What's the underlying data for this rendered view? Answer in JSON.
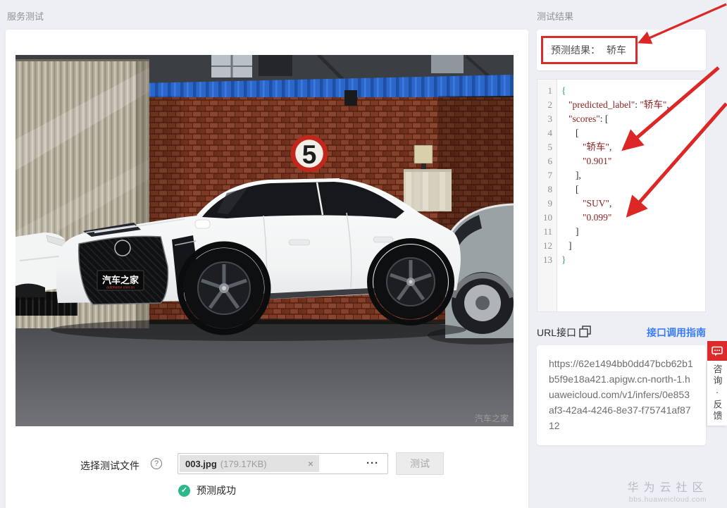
{
  "left_panel": {
    "header": "服务测试",
    "file_row": {
      "label": "选择测试文件",
      "help_glyph": "?",
      "file_chip": {
        "name": "003.jpg",
        "size": "(179.17KB)",
        "remove_glyph": "×"
      },
      "more_glyph": "···",
      "test_button": "测试"
    },
    "status": {
      "check_glyph": "✓",
      "text": "预测成功",
      "color": "#2bb98c"
    },
    "photo": {
      "speed_sign_text": "5",
      "plate_line1": "汽车之家",
      "plate_line2": "autohome.com.cn",
      "watermark": "汽车之家"
    }
  },
  "right_panel": {
    "header": "测试结果",
    "result_card": {
      "label": "预测结果：",
      "value": "轿车"
    },
    "accent_red": "#d92b2b",
    "link_blue": "#3b7cfa",
    "code_block": {
      "string_color": "#8b2121",
      "brace_color": "#2f9e44",
      "lines": [
        {
          "num": "1",
          "indent": 0,
          "segments": [
            {
              "text": "{",
              "cls": "brace"
            }
          ]
        },
        {
          "num": "2",
          "indent": 1,
          "segments": [
            {
              "text": "\"predicted_label\"",
              "cls": "str"
            },
            {
              "text": ": ",
              "cls": "plain"
            },
            {
              "text": "\"轿车\"",
              "cls": "str"
            },
            {
              "text": ",",
              "cls": "plain"
            }
          ]
        },
        {
          "num": "3",
          "indent": 1,
          "segments": [
            {
              "text": "\"scores\"",
              "cls": "str"
            },
            {
              "text": ": [",
              "cls": "plain"
            }
          ]
        },
        {
          "num": "4",
          "indent": 2,
          "segments": [
            {
              "text": "[",
              "cls": "plain"
            }
          ]
        },
        {
          "num": "5",
          "indent": 3,
          "segments": [
            {
              "text": "\"轿车\"",
              "cls": "str"
            },
            {
              "text": ",",
              "cls": "plain"
            }
          ]
        },
        {
          "num": "6",
          "indent": 3,
          "segments": [
            {
              "text": "\"0.901\"",
              "cls": "str"
            }
          ]
        },
        {
          "num": "7",
          "indent": 2,
          "segments": [
            {
              "text": "],",
              "cls": "plain"
            }
          ]
        },
        {
          "num": "8",
          "indent": 2,
          "segments": [
            {
              "text": "[",
              "cls": "plain"
            }
          ]
        },
        {
          "num": "9",
          "indent": 3,
          "segments": [
            {
              "text": "\"SUV\"",
              "cls": "str"
            },
            {
              "text": ",",
              "cls": "plain"
            }
          ]
        },
        {
          "num": "10",
          "indent": 3,
          "segments": [
            {
              "text": "\"0.099\"",
              "cls": "str"
            }
          ]
        },
        {
          "num": "11",
          "indent": 2,
          "segments": [
            {
              "text": "]",
              "cls": "plain"
            }
          ]
        },
        {
          "num": "12",
          "indent": 1,
          "segments": [
            {
              "text": "]",
              "cls": "plain"
            }
          ]
        },
        {
          "num": "13",
          "indent": 0,
          "segments": [
            {
              "text": "}",
              "cls": "brace"
            }
          ]
        }
      ]
    },
    "url_section": {
      "label": "URL接口",
      "guide_link": "接口调用指南"
    },
    "url_card": {
      "url": "https://62e1494bb0dd47bcb62b1b5f9e18a421.apigw.cn-north-1.huaweicloud.com/v1/infers/0e853af3-42a4-4246-8e37-f75741af8712"
    }
  },
  "feedback_tab": {
    "text": "咨询·反馈"
  },
  "site_watermark": {
    "title": "华为云社区",
    "subtitle": "bbs.huaweicloud.com"
  }
}
